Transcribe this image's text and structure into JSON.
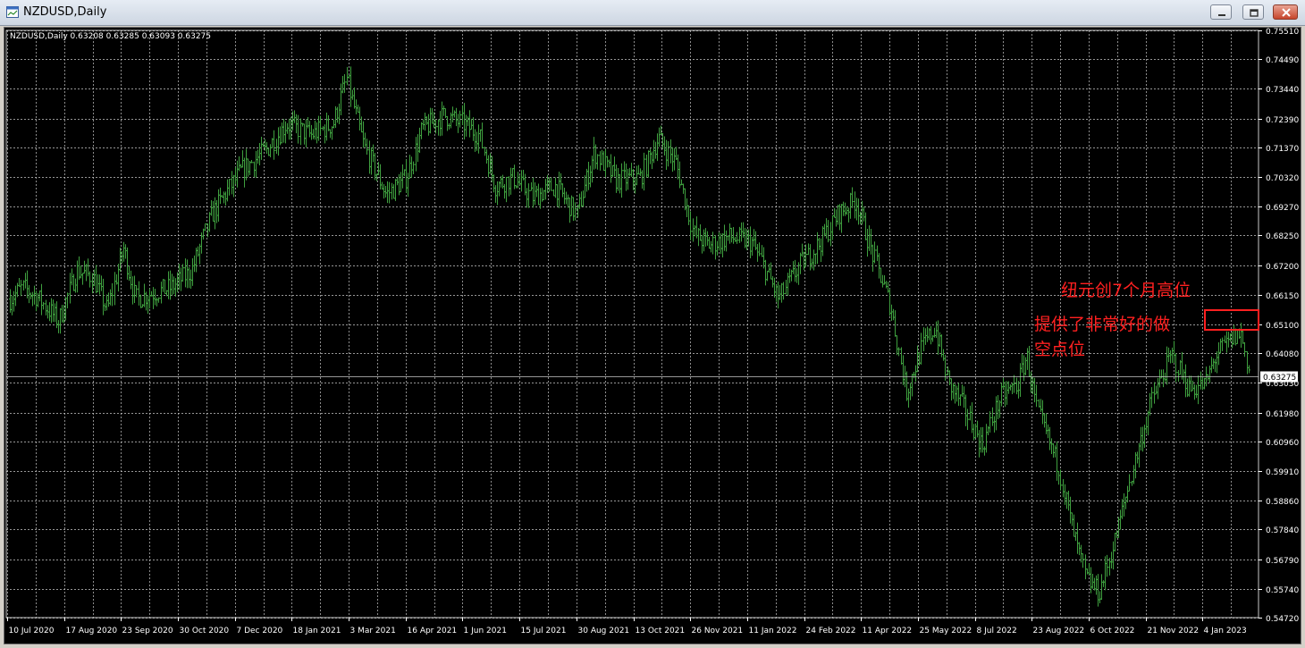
{
  "window": {
    "title": "NZDUSD,Daily",
    "icon": "chart-window-icon",
    "buttons": [
      {
        "name": "minimize-button",
        "icon": "minimize-icon"
      },
      {
        "name": "restore-button",
        "icon": "restore-icon"
      },
      {
        "name": "close-button",
        "icon": "close-icon"
      }
    ]
  },
  "chart_data": {
    "type": "bar",
    "subtype": "ohlc",
    "symbol_line": "NZDUSD,Daily  0.63208 0.63285 0.63093 0.63275",
    "colors": {
      "background": "#000000",
      "grid": "#c8c8c8",
      "bars": "#3fa03f",
      "text": "#ffffff",
      "annotation": "#ff2020",
      "price_tag_bg": "#ffffff",
      "price_tag_fg": "#000000"
    },
    "grid": true,
    "ylim": [
      0.5472,
      0.7551
    ],
    "y_ticks": [
      "0.75510",
      "0.74490",
      "0.73440",
      "0.72390",
      "0.71370",
      "0.70320",
      "0.69270",
      "0.68250",
      "0.67200",
      "0.66150",
      "0.65100",
      "0.64080",
      "0.63030",
      "0.61980",
      "0.60960",
      "0.59910",
      "0.58860",
      "0.57840",
      "0.56790",
      "0.55740",
      "0.54720"
    ],
    "x_ticks": [
      "10 Jul 2020",
      "17 Aug 2020",
      "23 Sep 2020",
      "30 Oct 2020",
      "7 Dec 2020",
      "18 Jan 2021",
      "3 Mar 2021",
      "16 Apr 2021",
      "1 Jun 2021",
      "15 Jul 2021",
      "30 Aug 2021",
      "13 Oct 2021",
      "26 Nov 2021",
      "11 Jan 2022",
      "24 Feb 2022",
      "11 Apr 2022",
      "25 May 2022",
      "8 Jul 2022",
      "23 Aug 2022",
      "6 Oct 2022",
      "21 Nov 2022",
      "4 Jan 2023"
    ],
    "current_price": "0.63275",
    "price_path": [
      [
        0,
        0.66
      ],
      [
        14,
        0.664
      ],
      [
        30,
        0.661
      ],
      [
        55,
        0.652
      ],
      [
        75,
        0.67
      ],
      [
        93,
        0.668
      ],
      [
        110,
        0.656
      ],
      [
        128,
        0.678
      ],
      [
        142,
        0.66
      ],
      [
        160,
        0.662
      ],
      [
        182,
        0.664
      ],
      [
        205,
        0.67
      ],
      [
        228,
        0.69
      ],
      [
        260,
        0.705
      ],
      [
        290,
        0.713
      ],
      [
        312,
        0.722
      ],
      [
        340,
        0.718
      ],
      [
        365,
        0.722
      ],
      [
        380,
        0.738
      ],
      [
        400,
        0.714
      ],
      [
        425,
        0.697
      ],
      [
        448,
        0.703
      ],
      [
        465,
        0.72
      ],
      [
        490,
        0.725
      ],
      [
        512,
        0.722
      ],
      [
        530,
        0.718
      ],
      [
        548,
        0.7
      ],
      [
        568,
        0.703
      ],
      [
        590,
        0.696
      ],
      [
        615,
        0.7
      ],
      [
        640,
        0.69
      ],
      [
        660,
        0.712
      ],
      [
        685,
        0.702
      ],
      [
        712,
        0.703
      ],
      [
        732,
        0.717
      ],
      [
        752,
        0.708
      ],
      [
        772,
        0.683
      ],
      [
        790,
        0.679
      ],
      [
        812,
        0.682
      ],
      [
        838,
        0.68
      ],
      [
        858,
        0.667
      ],
      [
        868,
        0.66
      ],
      [
        892,
        0.672
      ],
      [
        915,
        0.68
      ],
      [
        935,
        0.69
      ],
      [
        955,
        0.695
      ],
      [
        975,
        0.675
      ],
      [
        995,
        0.657
      ],
      [
        1012,
        0.627
      ],
      [
        1030,
        0.643
      ],
      [
        1045,
        0.65
      ],
      [
        1060,
        0.63
      ],
      [
        1075,
        0.623
      ],
      [
        1098,
        0.608
      ],
      [
        1118,
        0.625
      ],
      [
        1138,
        0.63
      ],
      [
        1148,
        0.64
      ],
      [
        1160,
        0.62
      ],
      [
        1185,
        0.6
      ],
      [
        1200,
        0.578
      ],
      [
        1215,
        0.561
      ],
      [
        1230,
        0.556
      ],
      [
        1248,
        0.575
      ],
      [
        1268,
        0.6
      ],
      [
        1290,
        0.625
      ],
      [
        1312,
        0.64
      ],
      [
        1332,
        0.628
      ],
      [
        1350,
        0.63
      ],
      [
        1362,
        0.64
      ],
      [
        1380,
        0.646
      ],
      [
        1390,
        0.648
      ],
      [
        1400,
        0.633
      ]
    ],
    "annotations": [
      {
        "text": "纽元创7个月高位"
      },
      {
        "text": "提供了非常好的做"
      },
      {
        "text": "空点位"
      }
    ]
  }
}
